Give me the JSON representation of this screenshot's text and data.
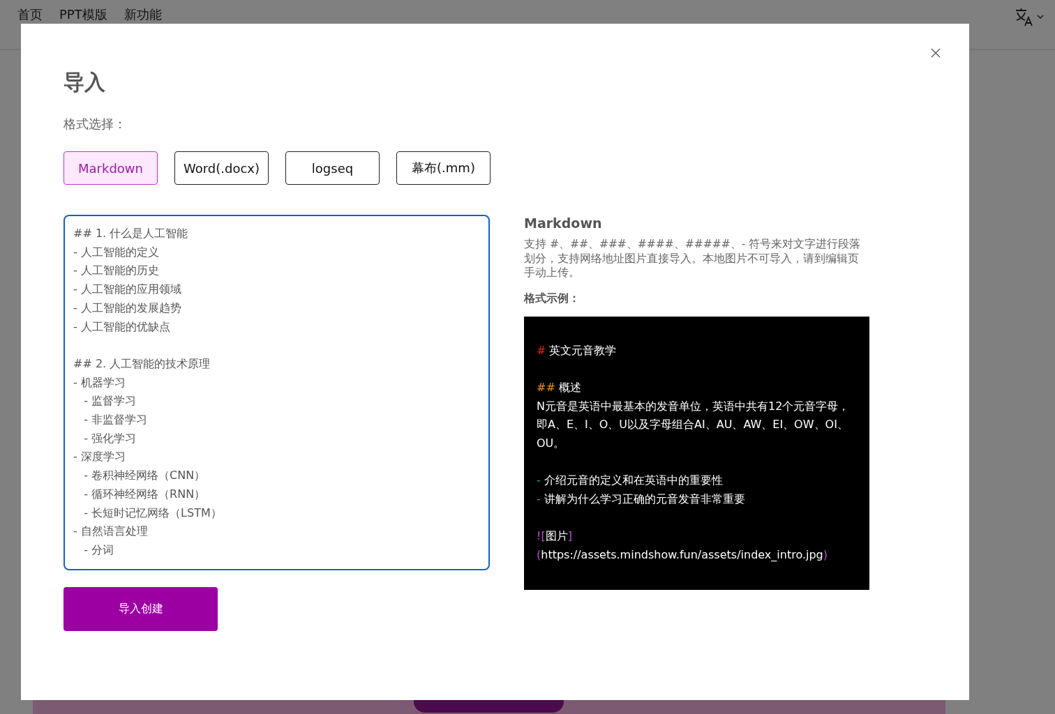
{
  "nav": {
    "items": [
      {
        "label": "首页"
      },
      {
        "label": "PPT模版"
      },
      {
        "label": "新功能"
      }
    ]
  },
  "dialog": {
    "title": "导入",
    "format_label": "格式选择：",
    "formats": [
      {
        "label": "Markdown",
        "selected": true
      },
      {
        "label": "Word(.docx)",
        "selected": false
      },
      {
        "label": "logseq",
        "selected": false
      },
      {
        "label": "幕布(.mm)",
        "selected": false
      }
    ],
    "editor": {
      "value": "## 1. 什么是人工智能\n- 人工智能的定义\n- 人工智能的历史\n- 人工智能的应用领域\n- 人工智能的发展趋势\n- 人工智能的优缺点\n\n## 2. 人工智能的技术原理\n- 机器学习\n   - 监督学习\n   - 非监督学习\n   - 强化学习\n- 深度学习\n   - 卷积神经网络（CNN）\n   - 循环神经网络（RNN）\n   - 长短时记忆网络（LSTM）\n- 自然语言处理\n   - 分词"
    },
    "submit": "导入创建",
    "info": {
      "heading": "Markdown",
      "description": "支持 #、##、###、####、#####、- 符号来对文字进行段落划分，支持网络地址图片直接导入。本地图片不可导入，请到编辑页手动上传。",
      "example_label": "格式示例：",
      "example": {
        "blocks": [
          {
            "lines": [
              {
                "kind": "h1",
                "mark": "#",
                "text": "英文元音教学"
              }
            ]
          },
          {
            "lines": [
              {
                "kind": "h2",
                "mark": "##",
                "text": "概述"
              },
              {
                "kind": "para",
                "text": " N元音是英语中最基本的发音单位，英语中共有12个元音字母，即A、E、I、O、U以及字母组合AI、AU、AW、EI、OW、OI、OU。"
              }
            ]
          },
          {
            "lines": [
              {
                "kind": "bullet",
                "mark": "-",
                "text": "介绍元音的定义和在英语中的重要性"
              },
              {
                "kind": "bullet",
                "mark": "-",
                "text": "讲解为什么学习正确的元音发音非常重要"
              }
            ]
          },
          {
            "lines": [
              {
                "kind": "image",
                "parts": [
                  "![",
                  "图片",
                  "](",
                  "https://assets.mindshow.fun/assets/index_intro.jpg",
                  ")"
                ]
              }
            ]
          }
        ]
      }
    }
  }
}
